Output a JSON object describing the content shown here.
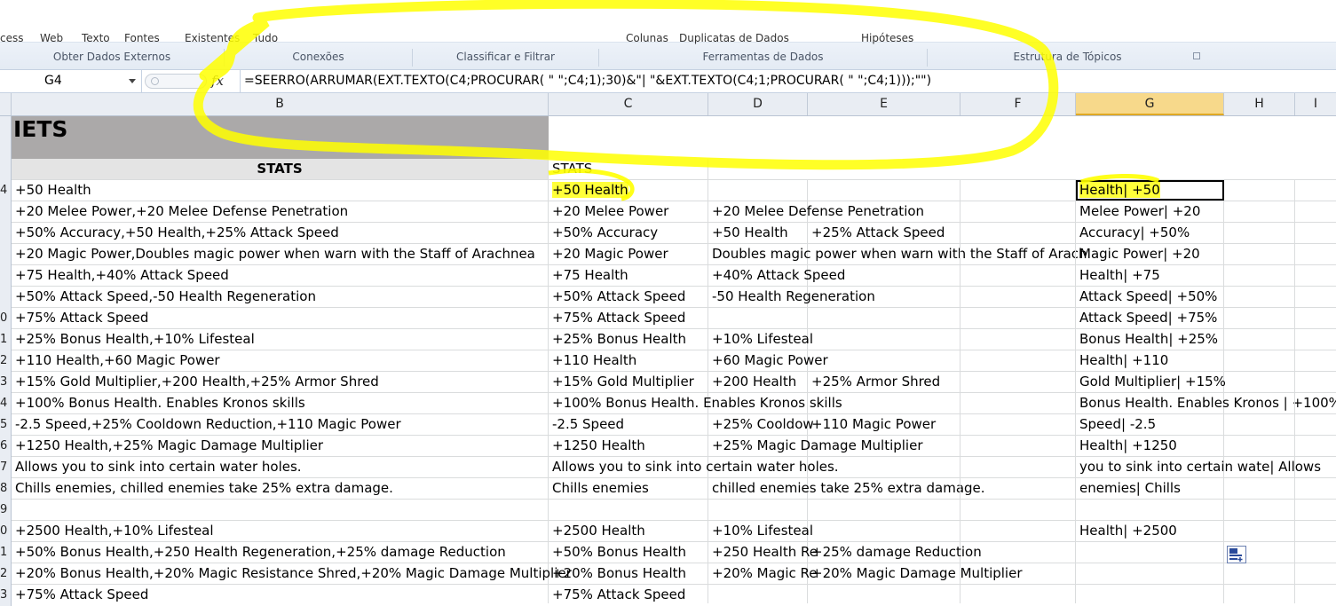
{
  "ribbon": {
    "cut_labels": [
      "cess",
      "Web",
      "Texto",
      "Fontes",
      "Existentes",
      "Tudo",
      "Colunas",
      "Duplicatas de Dados",
      "Hipóteses"
    ],
    "groups": [
      "Obter Dados Externos",
      "Conexões",
      "Classificar e Filtrar",
      "Ferramentas de Dados",
      "Estrutura de Tópicos"
    ]
  },
  "formula_bar": {
    "name_box": "G4",
    "fx_icon": "function-fx-icon",
    "formula": "=SEERRO(ARRUMAR(EXT.TEXTO(C4;PROCURAR( \" \";C4;1);30)&\"| \"&EXT.TEXTO(C4;1;PROCURAR( \" \";C4;1)));\"\")"
  },
  "columns": [
    "B",
    "C",
    "D",
    "E",
    "F",
    "G",
    "H",
    "I"
  ],
  "selected_column": "G",
  "row_headers": [
    "",
    "",
    "4",
    "",
    "",
    "",
    "",
    "",
    "0",
    "1",
    "2",
    "3",
    "4",
    "5",
    "6",
    "7",
    "8",
    "9",
    "0",
    "1",
    "2",
    "3"
  ],
  "sheet": {
    "title": "IETS",
    "header_b": "STATS",
    "header_c": "STATS",
    "rows": [
      {
        "b": "+50 Health",
        "c": "+50 Health",
        "d": "",
        "e": "",
        "g": "Health| +50"
      },
      {
        "b": "+20 Melee Power,+20 Melee Defense Penetration",
        "c": "+20 Melee Power",
        "d": "+20 Melee Defense Penetration",
        "e": "",
        "g": "Melee Power| +20"
      },
      {
        "b": "+50% Accuracy,+50 Health,+25% Attack Speed",
        "c": "+50% Accuracy",
        "d": "+50 Health",
        "e": "+25% Attack Speed",
        "g": "Accuracy| +50%"
      },
      {
        "b": "+20 Magic Power,Doubles magic power when warn with the Staff of Arachnea",
        "c": "+20 Magic Power",
        "d": "Doubles magic power when warn with the Staff of Arach",
        "e": "",
        "g": "Magic Power| +20"
      },
      {
        "b": "+75 Health,+40% Attack Speed",
        "c": "+75 Health",
        "d": "+40% Attack Speed",
        "e": "",
        "g": "Health| +75"
      },
      {
        "b": "+50% Attack Speed,-50 Health Regeneration",
        "c": "+50% Attack Speed",
        "d": "-50 Health Regeneration",
        "e": "",
        "g": "Attack Speed| +50%"
      },
      {
        "b": "+75% Attack Speed",
        "c": "+75% Attack Speed",
        "d": "",
        "e": "",
        "g": "Attack Speed| +75%"
      },
      {
        "b": "+25% Bonus Health,+10% Lifesteal",
        "c": "+25% Bonus Health",
        "d": "+10% Lifesteal",
        "e": "",
        "g": "Bonus Health| +25%"
      },
      {
        "b": "+110 Health,+60 Magic Power",
        "c": "+110 Health",
        "d": "+60 Magic Power",
        "e": "",
        "g": "Health| +110"
      },
      {
        "b": "+15% Gold Multiplier,+200 Health,+25% Armor Shred",
        "c": "+15% Gold Multiplier",
        "d": "+200 Health",
        "e": "+25% Armor Shred",
        "g": "Gold Multiplier| +15%"
      },
      {
        "b": "+100% Bonus Health. Enables Kronos skills",
        "c": "+100% Bonus Health. Enables Kronos skills",
        "d": "",
        "e": "",
        "g": "Bonus Health. Enables Kronos | +100%"
      },
      {
        "b": "-2.5 Speed,+25% Cooldown Reduction,+110 Magic Power",
        "c": "-2.5 Speed",
        "d": "+25% Cooldow",
        "e": "+110 Magic Power",
        "g": "Speed| -2.5"
      },
      {
        "b": "+1250 Health,+25% Magic Damage Multiplier",
        "c": "+1250 Health",
        "d": "+25% Magic Damage Multiplier",
        "e": "",
        "g": "Health| +1250"
      },
      {
        "b": "Allows you to sink into certain water holes.",
        "c": "Allows you to sink into certain water holes.",
        "d": "",
        "e": "",
        "g": "you to sink into certain wate| Allows"
      },
      {
        "b": "Chills enemies, chilled enemies take 25% extra damage.",
        "c": "Chills enemies",
        "d": " chilled enemies take 25% extra damage.",
        "e": "",
        "g": "enemies| Chills"
      },
      {
        "b": "",
        "c": "",
        "d": "",
        "e": "",
        "g": ""
      },
      {
        "b": "+2500 Health,+10% Lifesteal",
        "c": "+2500 Health",
        "d": "+10% Lifesteal",
        "e": "",
        "g": "Health| +2500"
      },
      {
        "b": "+50% Bonus Health,+250 Health Regeneration,+25% damage Reduction",
        "c": "+50% Bonus Health",
        "d": "+250 Health Re",
        "e": "+25% damage Reduction",
        "g": ""
      },
      {
        "b": "+20% Bonus Health,+20% Magic Resistance Shred,+20% Magic Damage Multiplier",
        "c": "+20% Bonus Health",
        "d": "+20% Magic Re",
        "e": "+20% Magic Damage Multiplier",
        "g": ""
      },
      {
        "b": "+75% Attack Speed",
        "c": "+75% Attack Speed",
        "d": "",
        "e": "",
        "g": ""
      }
    ]
  },
  "paste_options_icon": "paste-options-icon",
  "colors": {
    "highlighter": "#ffff3a",
    "title_band": "#aba9a9",
    "selected_header": "#f7d98b"
  }
}
